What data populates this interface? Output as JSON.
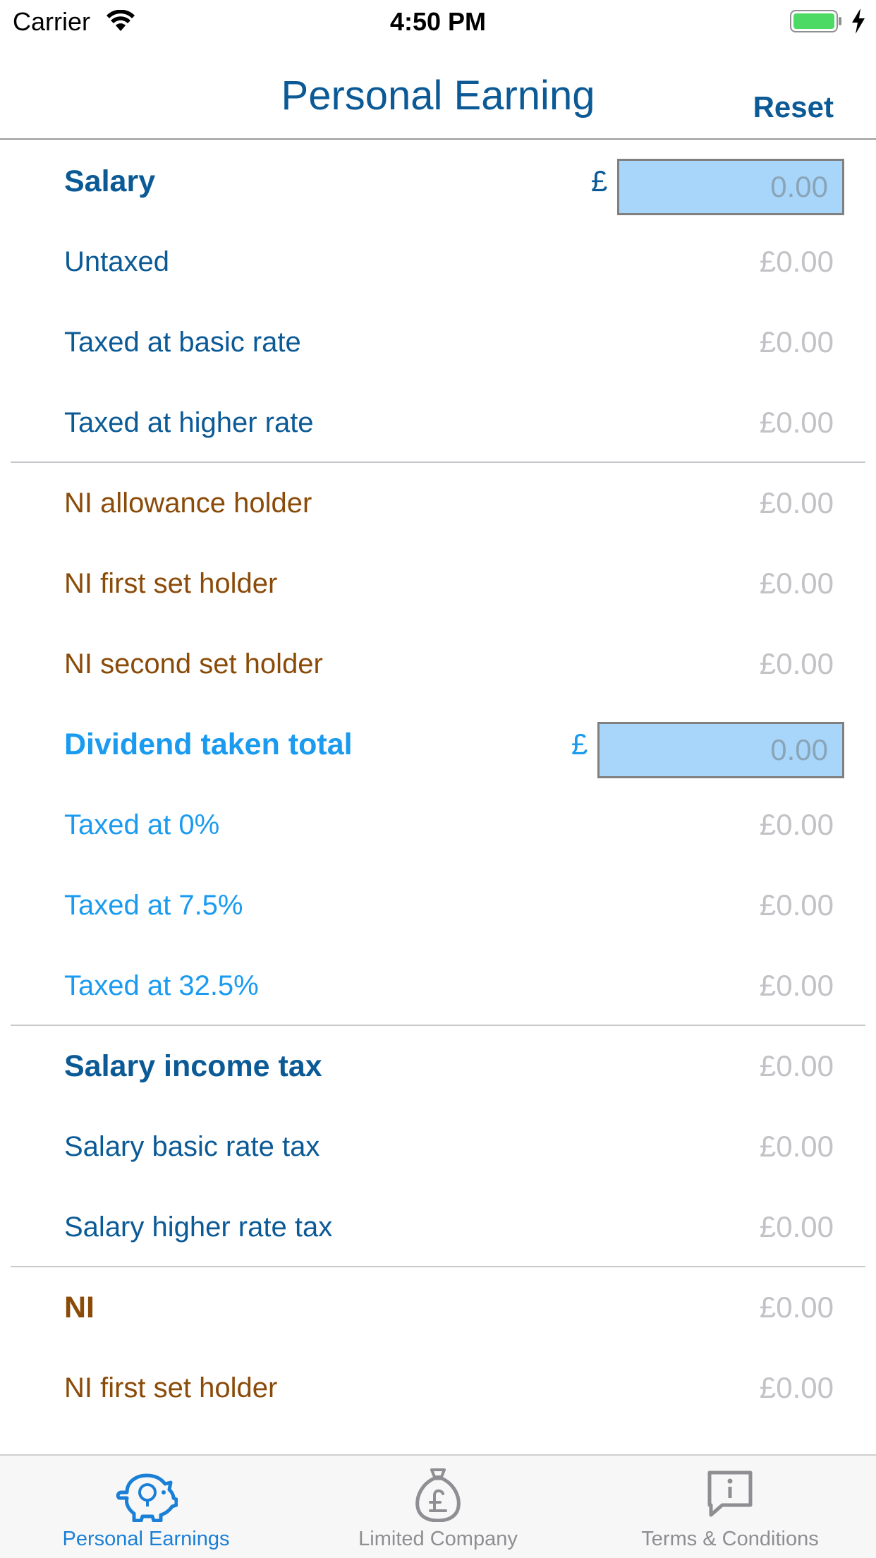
{
  "status_bar": {
    "carrier": "Carrier",
    "time": "4:50 PM",
    "battery_color": "#4cd964"
  },
  "nav": {
    "title": "Personal Earning",
    "reset_label": "Reset"
  },
  "salary": {
    "label": "Salary",
    "currency": "£",
    "placeholder": "0.00",
    "rows": [
      {
        "label": "Untaxed",
        "value": "£0.00"
      },
      {
        "label": "Taxed at basic rate",
        "value": "£0.00"
      },
      {
        "label": "Taxed at higher rate",
        "value": "£0.00"
      }
    ]
  },
  "ni_holders": {
    "rows": [
      {
        "label": "NI allowance holder",
        "value": "£0.00"
      },
      {
        "label": "NI first set holder",
        "value": "£0.00"
      },
      {
        "label": "NI second set holder",
        "value": "£0.00"
      }
    ]
  },
  "dividend": {
    "label": "Dividend taken total",
    "currency": "£",
    "placeholder": "0.00",
    "rows": [
      {
        "label": "Taxed at 0%",
        "value": "£0.00"
      },
      {
        "label": "Taxed at 7.5%",
        "value": "£0.00"
      },
      {
        "label": "Taxed at 32.5%",
        "value": "£0.00"
      }
    ]
  },
  "salary_tax": {
    "label": "Salary income tax",
    "value": "£0.00",
    "rows": [
      {
        "label": "Salary basic rate tax",
        "value": "£0.00"
      },
      {
        "label": "Salary higher rate tax",
        "value": "£0.00"
      }
    ]
  },
  "ni": {
    "label": "NI",
    "value": "£0.00",
    "rows": [
      {
        "label": "NI first set holder",
        "value": "£0.00"
      }
    ]
  },
  "tabs": [
    {
      "label": "Personal Earnings",
      "icon": "piggy-bank-icon",
      "active": true
    },
    {
      "label": "Limited Company",
      "icon": "money-bag-icon",
      "active": false
    },
    {
      "label": "Terms & Conditions",
      "icon": "info-bubble-icon",
      "active": false
    }
  ],
  "colors": {
    "navy": "#0b5a96",
    "brown": "#8a4b09",
    "sky": "#1a9bf0",
    "value_gray": "#c2c2c7",
    "input_bg": "#a8d6fa",
    "tab_active": "#1a7fd6",
    "tab_inactive": "#8e8e93"
  }
}
